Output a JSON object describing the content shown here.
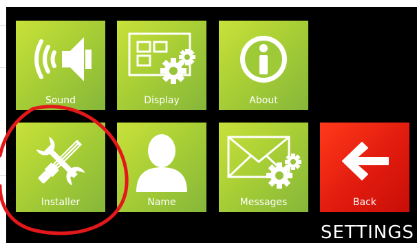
{
  "screen_title": "SETTINGS",
  "tiles": [
    {
      "label": "Sound",
      "icon": "speaker-icon"
    },
    {
      "label": "Display",
      "icon": "display-settings-icon"
    },
    {
      "label": "About",
      "icon": "info-icon"
    },
    {
      "label": "Installer",
      "icon": "tools-icon"
    },
    {
      "label": "Name",
      "icon": "person-icon"
    },
    {
      "label": "Messages",
      "icon": "envelope-settings-icon"
    },
    {
      "label": "Back",
      "icon": "arrow-left-icon"
    }
  ],
  "colors": {
    "tile_green": "#a9cf35",
    "tile_red": "#e11b0e",
    "background": "#000000",
    "annotation_circle": "#e3181a"
  }
}
